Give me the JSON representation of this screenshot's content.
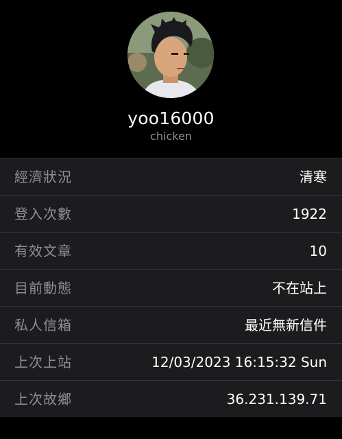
{
  "profile": {
    "avatar_alt": "profile photo",
    "username": "yoo16000",
    "nickname": "chicken"
  },
  "info_rows": [
    {
      "label": "經濟狀況",
      "value": "清寒"
    },
    {
      "label": "登入次數",
      "value": "1922"
    },
    {
      "label": "有效文章",
      "value": "10"
    },
    {
      "label": "目前動態",
      "value": "不在站上"
    },
    {
      "label": "私人信箱",
      "value": "最近無新信件"
    },
    {
      "label": "上次上站",
      "value": "12/03/2023 16:15:32 Sun"
    },
    {
      "label": "上次故鄉",
      "value": "36.231.139.71"
    }
  ],
  "colors": {
    "background": "#000000",
    "row_background": "#1c1c1e",
    "separator": "#38383a",
    "secondary_text": "#8e8e93",
    "primary_text": "#ffffff"
  }
}
